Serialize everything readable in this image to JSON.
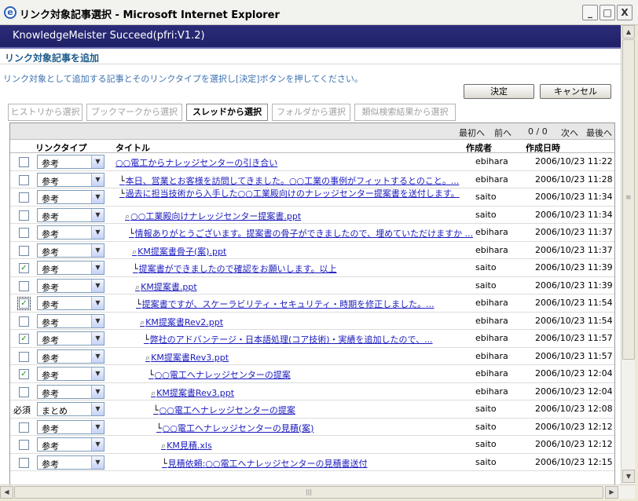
{
  "window": {
    "title": "リンク対象記事選択 - Microsoft Internet Explorer",
    "icon": "ie-icon",
    "controls": {
      "minimize": "_",
      "maximize": "□",
      "close": "X"
    }
  },
  "app": {
    "title": "KnowledgeMeister Succeed(pfri:V1.2)"
  },
  "section": {
    "title": "リンク対象記事を追加"
  },
  "instruction": "リンク対象として追加する記事とそのリンクタイプを選択し[決定]ボタンを押してください。",
  "buttons": {
    "ok": "決定",
    "cancel": "キャンセル"
  },
  "tabs": [
    {
      "label": "ヒストリから選択",
      "active": false
    },
    {
      "label": "ブックマークから選択",
      "active": false
    },
    {
      "label": "スレッドから選択",
      "active": true
    },
    {
      "label": "フォルダから選択",
      "active": false
    },
    {
      "label": "類似検索結果から選択",
      "active": false
    }
  ],
  "pager": {
    "first": "最初へ",
    "prev": "前へ",
    "count": "0 / 0",
    "next": "次へ",
    "last": "最後へ"
  },
  "columns": {
    "link_type": "リンクタイプ",
    "title": "タイトル",
    "author": "作成者",
    "date": "作成日時"
  },
  "rows": [
    {
      "checked": false,
      "required": "",
      "type": "参考",
      "prefix": "",
      "title": "○○電工からナレッジセンターの引き合い",
      "author": "ebihara",
      "date": "2006/10/23 11:22"
    },
    {
      "checked": false,
      "required": "",
      "type": "参考",
      "prefix": "└",
      "title": "本日、営業とお客様を訪問してきました。○○工業の事例がフィットするとのこと。...",
      "author": "ebihara",
      "date": "2006/10/23 11:28"
    },
    {
      "checked": false,
      "required": "",
      "type": "参考",
      "prefix": "└",
      "title": "過去に担当技術から入手した○○工業殿向けのナレッジセンター提案書を送付します。",
      "author": "saito",
      "date": "2006/10/23 11:34"
    },
    {
      "checked": false,
      "required": "",
      "type": "参考",
      "prefix": "",
      "clip": true,
      "title": "○○工業殿向けナレッジセンター提案書.ppt",
      "author": "saito",
      "date": "2006/10/23 11:34"
    },
    {
      "checked": false,
      "required": "",
      "type": "参考",
      "prefix": "└",
      "title": "情報ありがとうございます。提案書の骨子ができましたので、埋めていただけますか ...",
      "author": "ebihara",
      "date": "2006/10/23 11:37"
    },
    {
      "checked": false,
      "required": "",
      "type": "参考",
      "prefix": "",
      "clip": true,
      "title": "KM提案書骨子(案).ppt",
      "author": "ebihara",
      "date": "2006/10/23 11:37"
    },
    {
      "checked": true,
      "required": "",
      "type": "参考",
      "prefix": "└",
      "title": "提案書ができましたので確認をお願いします。以上",
      "author": "saito",
      "date": "2006/10/23 11:39"
    },
    {
      "checked": false,
      "required": "",
      "type": "参考",
      "prefix": "",
      "clip": true,
      "title": "KM提案書.ppt",
      "author": "saito",
      "date": "2006/10/23 11:39"
    },
    {
      "checked": true,
      "focused": true,
      "required": "",
      "type": "参考",
      "prefix": "└",
      "title": "提案書ですが、スケーラビリティ・セキュリティ・時期を修正しました。...",
      "author": "ebihara",
      "date": "2006/10/23 11:54"
    },
    {
      "checked": false,
      "required": "",
      "type": "参考",
      "prefix": "",
      "clip": true,
      "title": "KM提案書Rev2.ppt",
      "author": "ebihara",
      "date": "2006/10/23 11:54"
    },
    {
      "checked": true,
      "required": "",
      "type": "参考",
      "prefix": "└",
      "title": "弊社のアドバンテージ・日本語処理(コア技術)・実績を追加したので、...",
      "author": "ebihara",
      "date": "2006/10/23 11:57"
    },
    {
      "checked": false,
      "required": "",
      "type": "参考",
      "prefix": "",
      "clip": true,
      "title": "KM提案書Rev3.ppt",
      "author": "ebihara",
      "date": "2006/10/23 11:57"
    },
    {
      "checked": true,
      "required": "",
      "type": "参考",
      "prefix": "└",
      "title": "○○電工へナレッジセンターの提案",
      "author": "ebihara",
      "date": "2006/10/23 12:04"
    },
    {
      "checked": false,
      "required": "",
      "type": "参考",
      "prefix": "",
      "clip": true,
      "title": "KM提案書Rev3.ppt",
      "author": "ebihara",
      "date": "2006/10/23 12:04"
    },
    {
      "checked": null,
      "required": "必須",
      "type": "まとめ",
      "prefix": "└",
      "title": "○○電工へナレッジセンターの提案",
      "author": "saito",
      "date": "2006/10/23 12:08"
    },
    {
      "checked": false,
      "required": "",
      "type": "参考",
      "prefix": "└",
      "title": "○○電工へナレッジセンターの見積(案)",
      "author": "saito",
      "date": "2006/10/23 12:12"
    },
    {
      "checked": false,
      "required": "",
      "type": "参考",
      "prefix": "",
      "clip": true,
      "title": "KM見積.xls",
      "author": "saito",
      "date": "2006/10/23 12:12"
    },
    {
      "checked": false,
      "required": "",
      "type": "参考",
      "prefix": "└",
      "title": "見積依頼:○○電工へナレッジセンターの見積書送付",
      "author": "saito",
      "date": "2006/10/23 12:15"
    }
  ]
}
